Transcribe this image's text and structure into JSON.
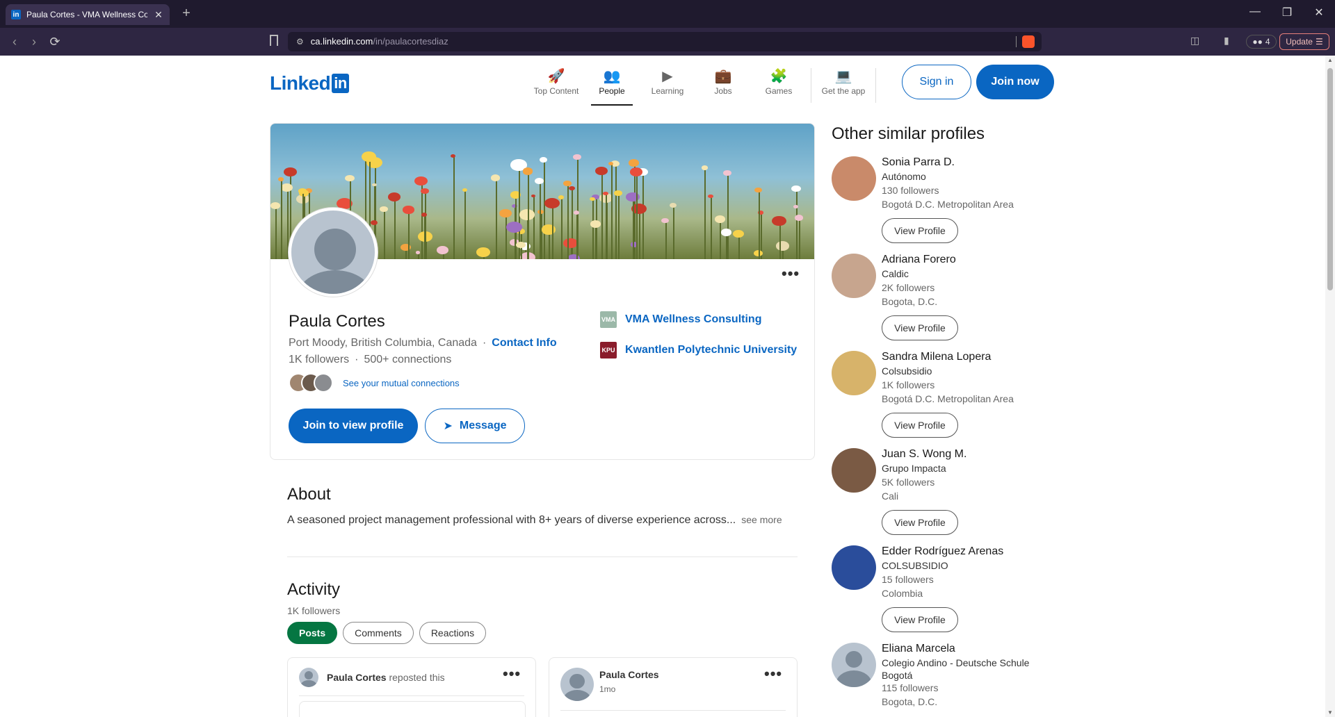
{
  "browser": {
    "tab_title": "Paula Cortes - VMA Wellness Co",
    "tab_favicon": "in",
    "url_host": "ca.linkedin.com",
    "url_path": "/in/paulacortesdiaz",
    "extensions_count": "4",
    "update_label": "Update"
  },
  "header": {
    "logo_text": "Linked",
    "logo_in": "in",
    "nav": [
      {
        "label": "Top Content",
        "icon": "rocket-icon",
        "glyph": "🚀"
      },
      {
        "label": "People",
        "icon": "people-icon",
        "glyph": "👥"
      },
      {
        "label": "Learning",
        "icon": "learning-icon",
        "glyph": "▶"
      },
      {
        "label": "Jobs",
        "icon": "briefcase-icon",
        "glyph": "💼"
      },
      {
        "label": "Games",
        "icon": "puzzle-icon",
        "glyph": "🧩"
      },
      {
        "label": "Get the app",
        "icon": "laptop-icon",
        "glyph": "💻"
      }
    ],
    "active_nav": "People",
    "sign_in": "Sign in",
    "join_now": "Join now"
  },
  "profile": {
    "name": "Paula Cortes",
    "location": "Port Moody, British Columbia, Canada",
    "dot": "·",
    "contact_info": "Contact Info",
    "followers": "1K followers",
    "connections": "500+ connections",
    "mutual_link": "See your mutual connections",
    "experience": [
      {
        "name": "VMA Wellness Consulting",
        "logo": "VMA",
        "color": "#9bb8a8"
      },
      {
        "name": "Kwantlen Polytechnic University",
        "logo": "KPU",
        "color": "#8a1c2b"
      }
    ],
    "join_to_view": "Join to view profile",
    "message": "Message"
  },
  "about": {
    "title": "About",
    "text": "A seasoned project management professional with 8+ years of diverse experience across...",
    "see_more": "see more"
  },
  "activity": {
    "title": "Activity",
    "followers": "1K followers",
    "tabs": [
      "Posts",
      "Comments",
      "Reactions"
    ],
    "active_tab": "Posts",
    "posts": [
      {
        "author": "Paula Cortes",
        "action": "reposted this",
        "time": ""
      },
      {
        "author": "Paula Cortes",
        "action": "",
        "time": "1mo"
      }
    ]
  },
  "sidebar": {
    "title": "Other similar profiles",
    "view_profile_label": "View Profile",
    "profiles": [
      {
        "name": "Sonia Parra D.",
        "headline": "Autónomo",
        "followers": "130 followers",
        "location": "Bogotá D.C. Metropolitan Area",
        "avatar_color": "#c98a6a"
      },
      {
        "name": "Adriana Forero",
        "headline": "Caldic",
        "followers": "2K followers",
        "location": "Bogota, D.C.",
        "avatar_color": "#c7a58e"
      },
      {
        "name": "Sandra Milena Lopera",
        "headline": "Colsubsidio",
        "followers": "1K followers",
        "location": "Bogotá D.C. Metropolitan Area",
        "avatar_color": "#d7b36a"
      },
      {
        "name": "Juan S. Wong M.",
        "headline": "Grupo Impacta",
        "followers": "5K followers",
        "location": "Cali",
        "avatar_color": "#7a5a44"
      },
      {
        "name": "Edder Rodríguez Arenas",
        "headline": "COLSUBSIDIO",
        "followers": "15 followers",
        "location": "Colombia",
        "avatar_color": "#2a4d9b"
      },
      {
        "name": "Eliana Marcela",
        "headline": "Colegio Andino - Deutsche Schule",
        "headline2": "Bogotá",
        "followers": "115 followers",
        "location": "Bogota, D.C.",
        "avatar_color": "#b8c3cf"
      }
    ]
  }
}
